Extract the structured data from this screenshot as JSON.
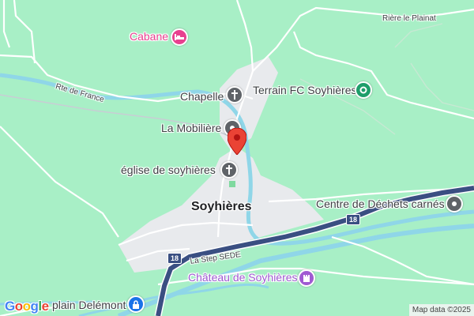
{
  "map": {
    "labels": {
      "cabane": "Cabane",
      "riere_le_plainat": "Rière le Plainat",
      "rte_de_france": "Rte de France",
      "chapelle": "Chapelle",
      "terrain_fc": "Terrain FC Soyhières",
      "la_mobiliere": "La Mobilière",
      "eglise": "église de soyhières",
      "soyhieres": "Soyhières",
      "centre_dechets": "Centre de Déchets carnés",
      "la_step_sede": "La Step SEDE",
      "chateau": "Château de Soyhières",
      "plain_delemont": "plain Delémont"
    },
    "route_shields": {
      "right": "18",
      "left": "18"
    },
    "icons": {
      "cabane": "bed-icon",
      "chapelle": "cross-icon",
      "terrain_fc": "sports-field-icon",
      "la_mobiliere": "office-icon",
      "eglise": "cross-icon",
      "centre_dechets": "recycling-center-icon",
      "chateau": "castle-icon",
      "plain_delemont": "lock-icon",
      "selected_place": "map-pin-icon"
    },
    "colors": {
      "land": "#a8efc6",
      "water": "#8fd6e8",
      "highway": "#3a4f82",
      "urban": "#e8eaed",
      "lodging_pink": "#e8408f",
      "landmark_grey": "#5f6368",
      "park_green": "#1e9e6a",
      "attraction_purple": "#a05ad2",
      "marker_red": "#ea4335"
    },
    "google_logo": "Google",
    "attribution": "Map data ©2025"
  }
}
